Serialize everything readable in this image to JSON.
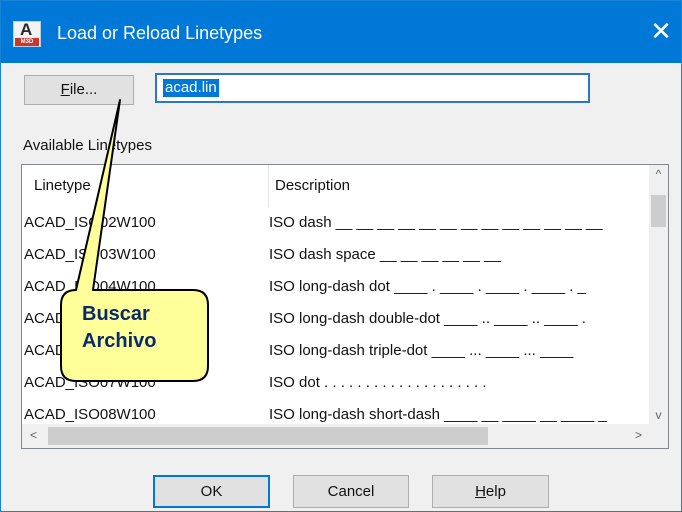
{
  "window": {
    "title": "Load or Reload Linetypes",
    "icon_big": "A",
    "icon_small": "M3D",
    "close_glyph": "✕"
  },
  "file_row": {
    "file_button_mnemonic": "F",
    "file_button_rest": "ile...",
    "file_name_value": "acad.lin"
  },
  "list": {
    "group_label": "Available Linetypes",
    "columns": [
      "Linetype",
      "Description"
    ],
    "rows": [
      {
        "linetype": "ACAD_ISO02W100",
        "description": "ISO dash __ __ __ __ __ __ __ __ __ __ __ __ __"
      },
      {
        "linetype": "ACAD_ISO03W100",
        "description": "ISO dash space __    __    __    __    __    __"
      },
      {
        "linetype": "ACAD_ISO04W100",
        "description": "ISO long-dash dot ____ . ____ . ____ . ____ . _"
      },
      {
        "linetype": "ACAD_ISO05W100",
        "description": "ISO long-dash double-dot ____ .. ____ .. ____ ."
      },
      {
        "linetype": "ACAD_ISO06W100",
        "description": "ISO long-dash triple-dot ____ ... ____ ... ____"
      },
      {
        "linetype": "ACAD_ISO07W100",
        "description": "ISO dot . . . . . . . . . . . . . . . . . . . ."
      },
      {
        "linetype": "ACAD_ISO08W100",
        "description": "ISO long-dash short-dash ____ __ ____ __ ____ _"
      }
    ],
    "scroll_up": "^",
    "scroll_down": "v",
    "scroll_left": "<",
    "scroll_right": ">"
  },
  "buttons": {
    "ok": "OK",
    "cancel": "Cancel",
    "help_mnemonic": "H",
    "help_rest": "elp"
  },
  "annotation": {
    "line1": "Buscar",
    "line2": "Archivo",
    "fill_color": "#ffff99",
    "stroke_color": "#000000"
  },
  "colors": {
    "titlebar": "#0078d7",
    "selection": "#0078d7",
    "dialog_bg": "#f0f0f0"
  }
}
